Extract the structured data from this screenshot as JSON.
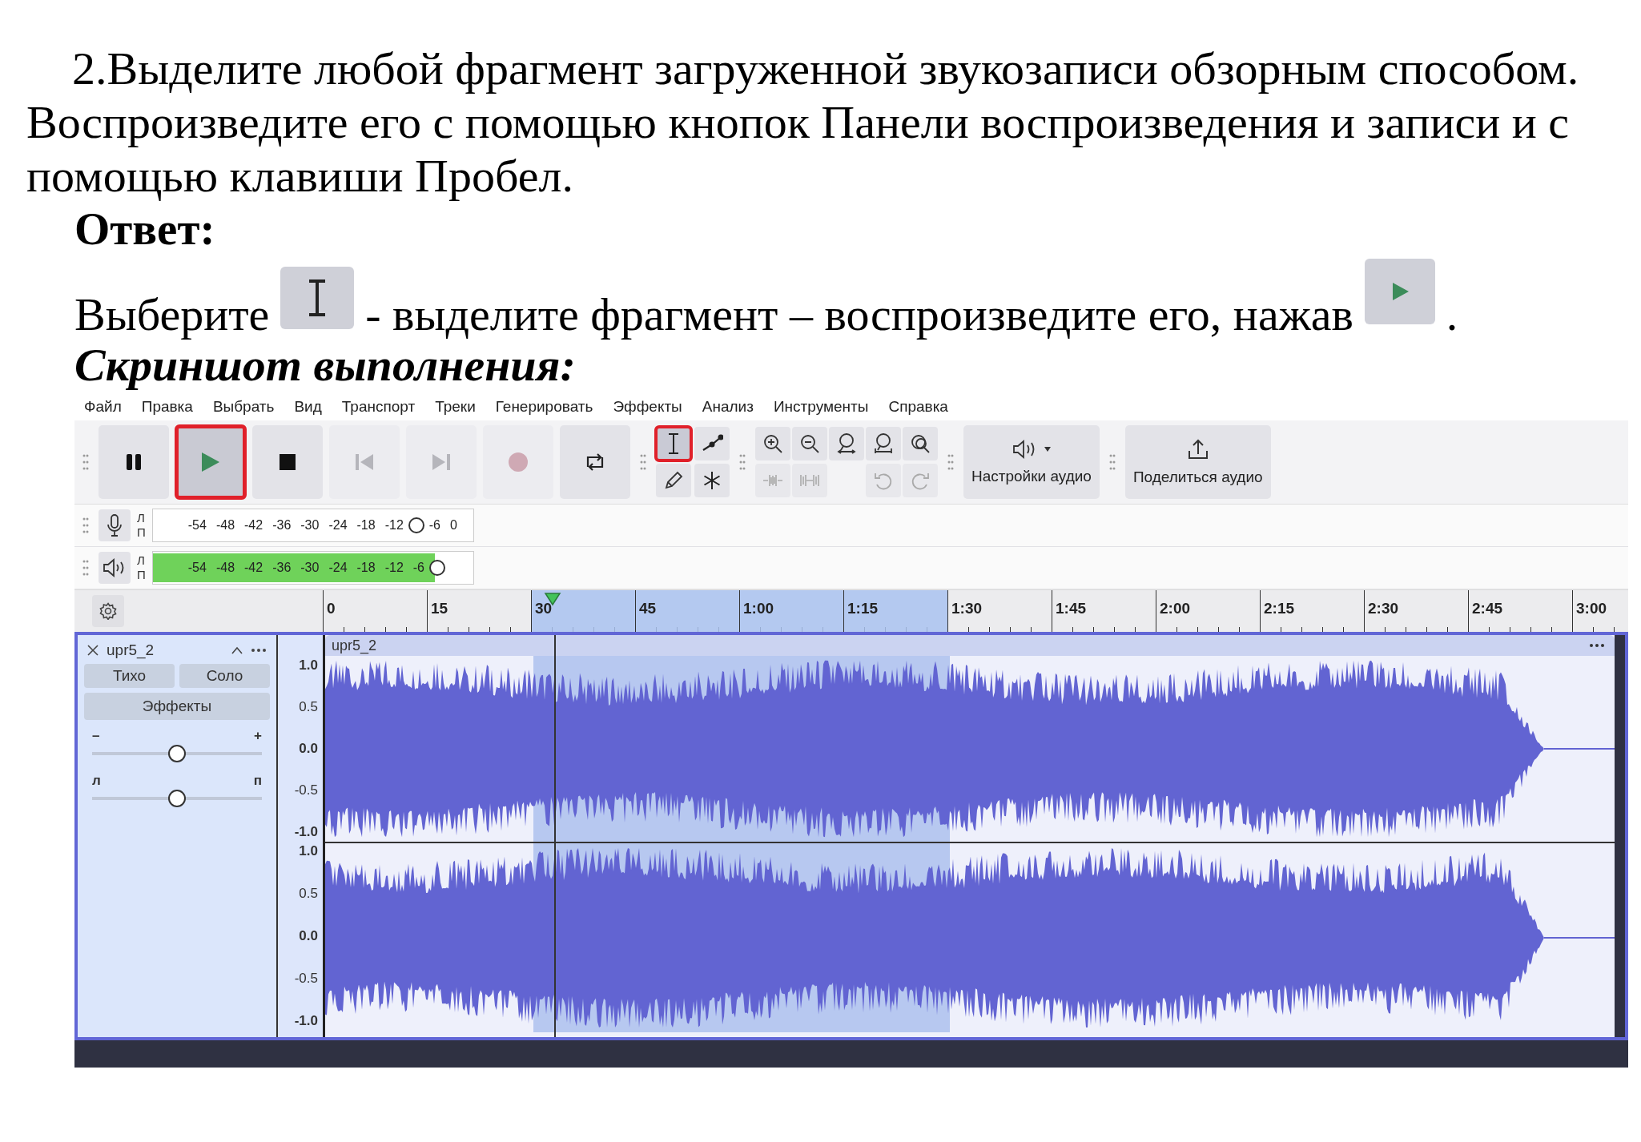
{
  "task": {
    "text": "2.Выделите любой фрагмент загруженной звукозаписи обзорным способом. Воспроизведите его с помощью кнопок Панели воспроизведения и записи и с помощью клавиши Пробел."
  },
  "answer_heading": "Ответ:",
  "answer_line": {
    "before": "Выберите",
    "middle": "- выделите фрагмент – воспроизведите его, нажав",
    "after": "."
  },
  "screenshot_heading": "Скриншот выполнения:",
  "app": {
    "menu": [
      "Файл",
      "Правка",
      "Выбрать",
      "Вид",
      "Транспорт",
      "Треки",
      "Генерировать",
      "Эффекты",
      "Анализ",
      "Инструменты",
      "Справка"
    ],
    "transport": [
      {
        "kind": "pause",
        "disabled": false,
        "highlighted": false
      },
      {
        "kind": "play",
        "disabled": false,
        "highlighted": true
      },
      {
        "kind": "stop",
        "disabled": false,
        "highlighted": false
      },
      {
        "kind": "skip_start",
        "disabled": true,
        "highlighted": false
      },
      {
        "kind": "skip_end",
        "disabled": true,
        "highlighted": false
      },
      {
        "kind": "record",
        "disabled": true,
        "highlighted": false
      },
      {
        "kind": "loop",
        "disabled": false,
        "highlighted": false
      }
    ],
    "tools": [
      {
        "kind": "select",
        "selected": true,
        "highlighted": true
      },
      {
        "kind": "envelope",
        "selected": false,
        "highlighted": false
      },
      {
        "kind": "draw",
        "selected": false,
        "highlighted": false
      },
      {
        "kind": "multi",
        "selected": false,
        "highlighted": false
      }
    ],
    "edit_top": [
      {
        "kind": "zoom_in",
        "disabled": false
      },
      {
        "kind": "zoom_out",
        "disabled": false
      },
      {
        "kind": "fit_selection",
        "disabled": false
      },
      {
        "kind": "fit_project",
        "disabled": false
      },
      {
        "kind": "zoom_toggle",
        "disabled": false
      }
    ],
    "edit_bottom": [
      {
        "kind": "trim",
        "disabled": true
      },
      {
        "kind": "silence",
        "disabled": true
      },
      {
        "kind": "undo",
        "disabled": true
      },
      {
        "kind": "redo",
        "disabled": true
      }
    ],
    "audio_setup": {
      "label": "Настройки аудио"
    },
    "share": {
      "label": "Поделиться аудио"
    },
    "meters": [
      {
        "kind": "record",
        "channels": [
          "Л",
          "П"
        ],
        "scale": [
          "-54",
          "-48",
          "-42",
          "-36",
          "-30",
          "-24",
          "-18",
          "-12",
          "-6",
          "0"
        ],
        "level": 0
      },
      {
        "kind": "playback",
        "channels": [
          "Л",
          "П"
        ],
        "scale": [
          "-54",
          "-48",
          "-42",
          "-36",
          "-30",
          "-24",
          "-18",
          "-12",
          "-6"
        ],
        "level": 0.88
      }
    ],
    "timeline": [
      {
        "text": "0",
        "selected": false
      },
      {
        "text": "15",
        "selected": false
      },
      {
        "text": "30",
        "selected": true
      },
      {
        "text": "45",
        "selected": true
      },
      {
        "text": "1:00",
        "selected": true
      },
      {
        "text": "1:15",
        "selected": true
      },
      {
        "text": "1:30",
        "selected": false
      },
      {
        "text": "1:45",
        "selected": false
      },
      {
        "text": "2:00",
        "selected": false
      },
      {
        "text": "2:15",
        "selected": false
      },
      {
        "text": "2:30",
        "selected": false
      },
      {
        "text": "2:45",
        "selected": false
      },
      {
        "text": "3:00",
        "selected": false
      }
    ],
    "track": {
      "name": "upr5_2",
      "buttons": [
        {
          "label": "Тихо",
          "selected": false
        },
        {
          "label": "Соло",
          "selected": false
        }
      ],
      "effects": "Эффекты",
      "gain": {
        "min": "–",
        "max": "+",
        "level": 0.5
      },
      "pan": {
        "min": "л",
        "max": "п",
        "level": 0.5
      },
      "clip_name": "upr5_2",
      "channels": [
        {
          "ruler": [
            "1.0",
            "0.5",
            "0.0",
            "-0.5",
            "-1.0"
          ]
        },
        {
          "ruler": [
            "1.0",
            "0.5",
            "0.0",
            "-0.5",
            "-1.0"
          ]
        }
      ]
    }
  }
}
